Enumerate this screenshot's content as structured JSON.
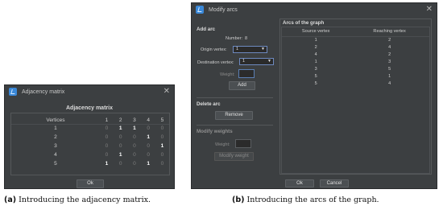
{
  "window_a": {
    "title": "Adjacency matrix",
    "heading": "Adjacency matrix",
    "columns": [
      "Vertices",
      "1",
      "2",
      "3",
      "4",
      "5"
    ],
    "rows": [
      [
        "1",
        "0",
        "1",
        "1",
        "0",
        "0"
      ],
      [
        "2",
        "0",
        "0",
        "0",
        "1",
        "0"
      ],
      [
        "3",
        "0",
        "0",
        "0",
        "0",
        "1"
      ],
      [
        "4",
        "0",
        "1",
        "0",
        "0",
        "0"
      ],
      [
        "5",
        "1",
        "0",
        "0",
        "1",
        "0"
      ]
    ],
    "ok_label": "Ok"
  },
  "window_b": {
    "title": "Modify arcs",
    "add_arc": {
      "section_title": "Add arc",
      "number_label": "Number:",
      "number_value": "8",
      "origin_label": "Origin vertex:",
      "origin_value": "1",
      "destination_label": "Destination vertex:",
      "destination_value": "1",
      "weight_label": "Weight:",
      "weight_value": "",
      "add_button": "Add"
    },
    "delete_arc": {
      "section_title": "Delete arc",
      "remove_button": "Remove"
    },
    "modify_weights": {
      "section_title": "Modify weights",
      "weight_label": "Weight:",
      "weight_value": "",
      "modify_button": "Modify weight"
    },
    "arcs_panel": {
      "title": "Arcs of the graph",
      "columns": [
        "Source vertex",
        "Reaching vertex"
      ],
      "rows": [
        [
          "1",
          "2"
        ],
        [
          "2",
          "4"
        ],
        [
          "4",
          "2"
        ],
        [
          "1",
          "3"
        ],
        [
          "3",
          "5"
        ],
        [
          "5",
          "1"
        ],
        [
          "5",
          "4"
        ]
      ]
    },
    "ok_label": "Ok",
    "cancel_label": "Cancel"
  },
  "captions": {
    "a_letter": "(a)",
    "a_text": "Introducing the adjacency matrix.",
    "b_letter": "(b)",
    "b_text": "Introducing the arcs of the graph."
  },
  "colors": {
    "window_bg": "#3c3f41",
    "accent": "#3a88d8",
    "field_border": "#5b7fb4"
  }
}
